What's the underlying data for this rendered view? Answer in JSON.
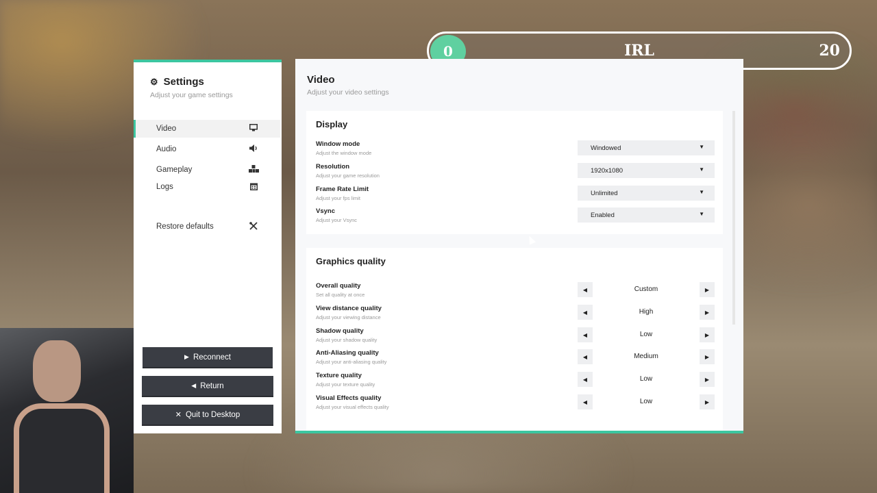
{
  "scoreboard": {
    "left_score": "0",
    "title": "IRL",
    "right_score": "20"
  },
  "sidebar": {
    "title": "Settings",
    "subtitle": "Adjust your game settings",
    "items": [
      {
        "label": "Video",
        "icon": "monitor-icon",
        "active": true
      },
      {
        "label": "Audio",
        "icon": "speaker-icon",
        "active": false
      },
      {
        "label": "Gameplay",
        "icon": "blocks-icon",
        "active": false
      },
      {
        "label": "Logs",
        "icon": "calendar-icon",
        "active": false
      },
      {
        "label": "Restore defaults",
        "icon": "tools-icon",
        "active": false
      }
    ],
    "buttons": {
      "reconnect": "Reconnect",
      "return": "Return",
      "quit": "Quit to Desktop"
    }
  },
  "main": {
    "title": "Video",
    "subtitle": "Adjust your video settings",
    "display": {
      "title": "Display",
      "rows": [
        {
          "label": "Window mode",
          "desc": "Adjust the window mode",
          "value": "Windowed"
        },
        {
          "label": "Resolution",
          "desc": "Adjust your game resolution",
          "value": "1920x1080"
        },
        {
          "label": "Frame Rate Limit",
          "desc": "Adjust your fps limit",
          "value": "Unlimited"
        },
        {
          "label": "Vsync",
          "desc": "Adjust your Vsync",
          "value": "Enabled"
        }
      ]
    },
    "graphics": {
      "title": "Graphics quality",
      "rows": [
        {
          "label": "Overall quality",
          "desc": "Set all quality at once",
          "value": "Custom"
        },
        {
          "label": "View distance quality",
          "desc": "Adjust your viewing distance",
          "value": "High"
        },
        {
          "label": "Shadow quality",
          "desc": "Adjust your shadow quality",
          "value": "Low"
        },
        {
          "label": "Anti-Aliasing quality",
          "desc": "Adjust your anti-aliasing quality",
          "value": "Medium"
        },
        {
          "label": "Texture quality",
          "desc": "Adjust your texture quality",
          "value": "Low"
        },
        {
          "label": "Visual Effects quality",
          "desc": "Adjust your visual effects quality",
          "value": "Low"
        }
      ]
    }
  },
  "colors": {
    "accent": "#3cc6a0",
    "button_bg": "#3a3d44"
  }
}
